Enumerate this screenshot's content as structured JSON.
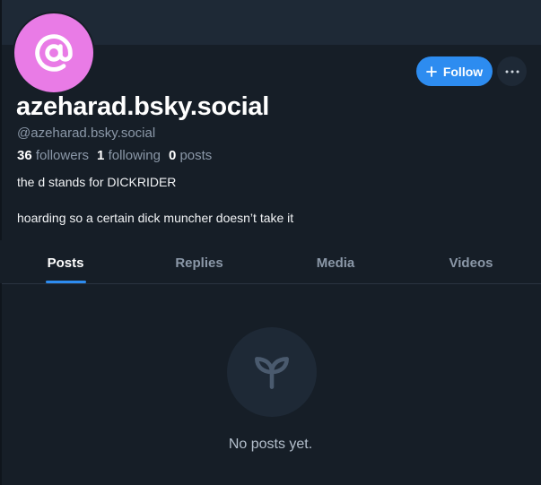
{
  "profile": {
    "display_name": "azeharad.bsky.social",
    "handle": "@azeharad.bsky.social",
    "avatar_icon": "at-sign-icon",
    "avatar_color": "#e97be6",
    "stats": {
      "followers_count": "36",
      "followers_label": "followers",
      "following_count": "1",
      "following_label": "following",
      "posts_count": "0",
      "posts_label": "posts"
    },
    "bio": [
      "the d stands for DICKRIDER",
      "hoarding so a certain dick muncher doesn’t take it"
    ]
  },
  "actions": {
    "follow_label": "Follow",
    "follow_icon": "plus-icon",
    "more_icon": "ellipsis-icon"
  },
  "tabs": [
    {
      "label": "Posts",
      "active": true
    },
    {
      "label": "Replies",
      "active": false
    },
    {
      "label": "Media",
      "active": false
    },
    {
      "label": "Videos",
      "active": false
    }
  ],
  "empty_state": {
    "icon": "sprout-icon",
    "message": "No posts yet."
  },
  "colors": {
    "background": "#161e27",
    "banner": "#1e2936",
    "accent": "#2d8cf0",
    "muted_text": "#8b98a8"
  }
}
